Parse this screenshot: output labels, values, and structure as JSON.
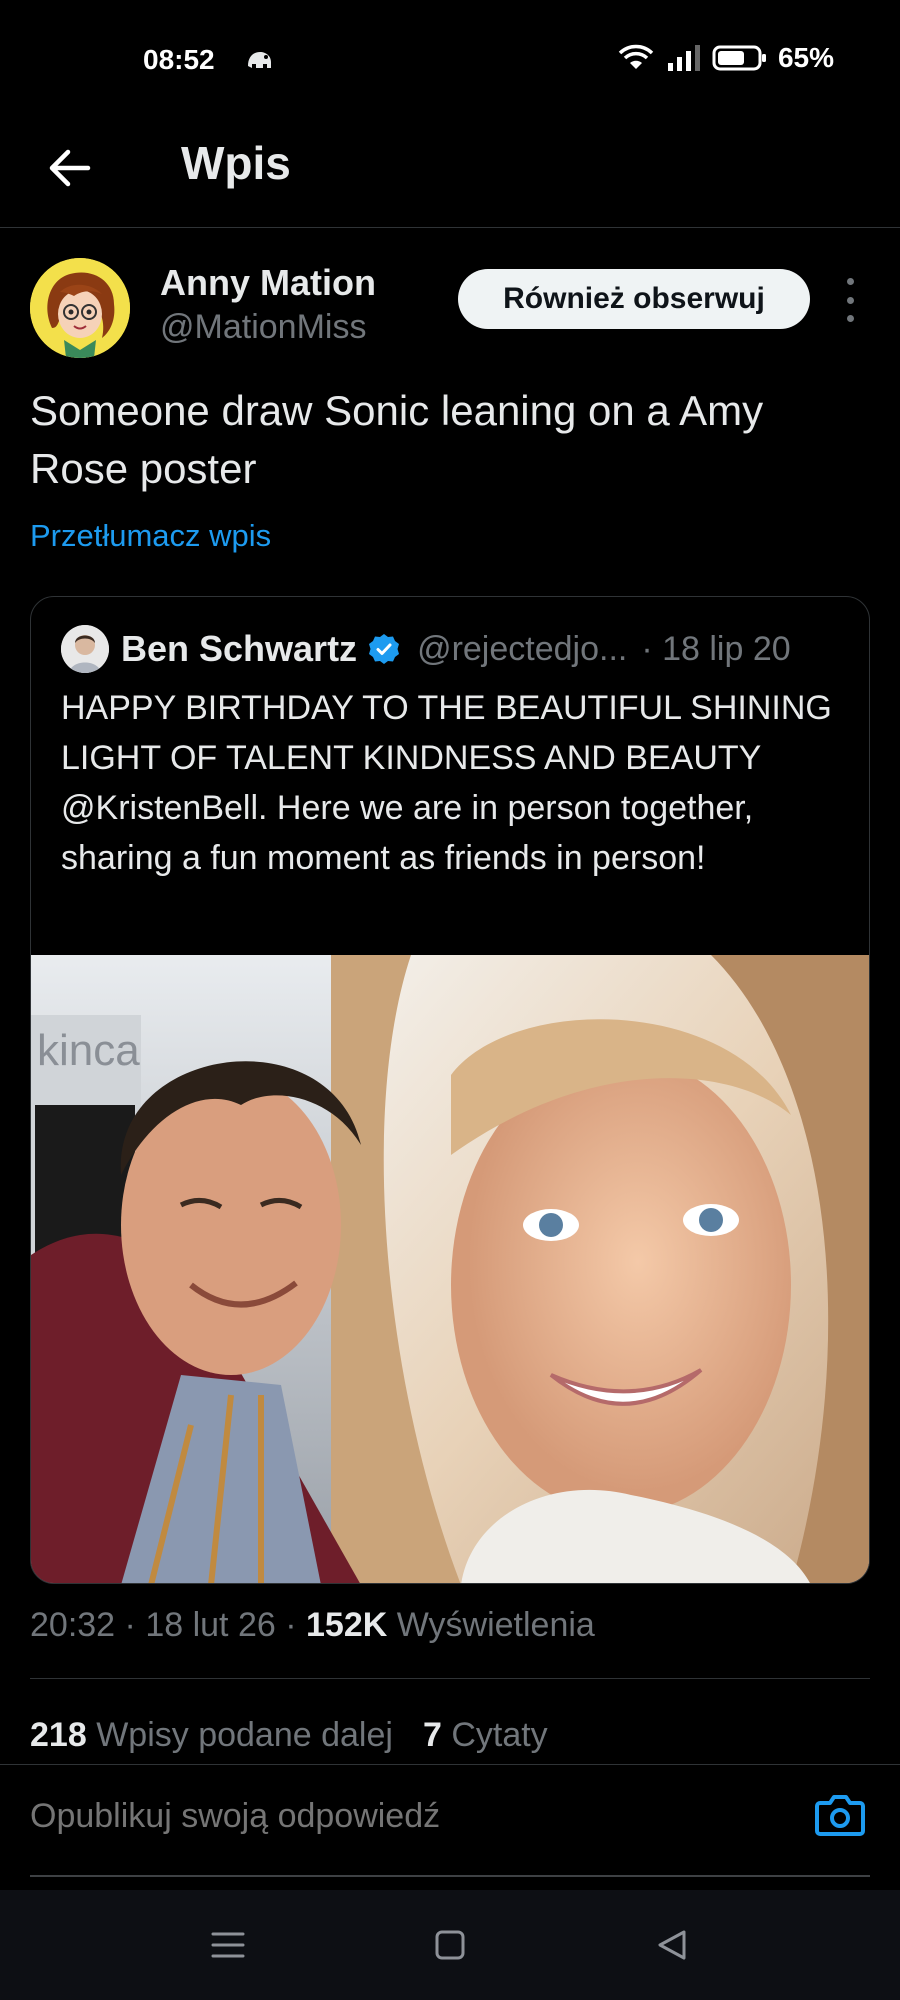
{
  "status_bar": {
    "time": "08:52",
    "battery": "65%",
    "icons": [
      "app-notification-icon",
      "wifi-icon",
      "signal-icon",
      "battery-icon"
    ]
  },
  "header": {
    "title": "Wpis",
    "back_icon": "arrow-left-icon"
  },
  "author": {
    "name": "Anny Mation",
    "handle": "@MationMiss",
    "follow_label": "Również obserwuj",
    "more_icon": "more-vertical-icon"
  },
  "tweet": {
    "text": "Someone draw Sonic leaning on a Amy Rose poster",
    "translate_label": "Przetłumacz wpis"
  },
  "quote": {
    "name": "Ben Schwartz",
    "handle": "@rejectedjo...",
    "date": "· 18 lip 20",
    "text": "HAPPY BIRTHDAY TO THE BEAUTIFUL SHINING LIGHT OF TALENT KINDNESS AND BEAUTY @KristenBell. Here we are in person together, sharing a fun moment as friends in person!",
    "photo_alt": "photo"
  },
  "meta": {
    "time": "20:32",
    "date": "18 lut 26",
    "views": "152K",
    "views_label": "Wyświetlenia",
    "sep": "·"
  },
  "stats": {
    "reposts": "218",
    "reposts_label": "Wpisy podane dalej",
    "quotes": "7",
    "quotes_label": "Cytaty"
  },
  "reply": {
    "placeholder": "Opublikuj swoją odpowiedź",
    "camera_icon": "camera-icon"
  },
  "colors": {
    "background": "#000000",
    "accent": "#1d9bf0",
    "muted": "#71767b",
    "text": "#e7e9ea",
    "border": "#2f3336"
  }
}
